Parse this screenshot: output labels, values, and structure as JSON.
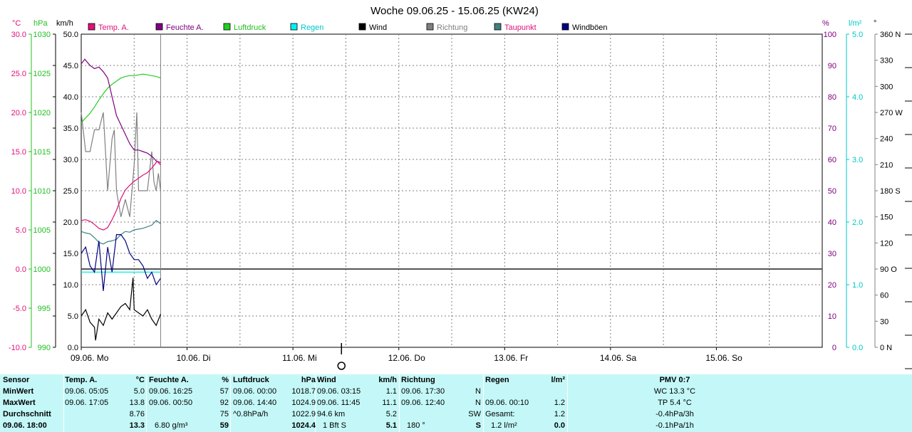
{
  "title": "Woche 09.06.25 - 15.06.25 (KW24)",
  "colors": {
    "temp": "#e0107a",
    "feuchte": "#800080",
    "luftdruck": "#20d020",
    "regen": "#00e0e0",
    "wind": "#000000",
    "richtung": "#808080",
    "taupunkt": "#408080",
    "windboeen": "#000080",
    "table_bg": "#c4f8f8"
  },
  "legend": [
    {
      "key": "temp",
      "label": "Temp. A.",
      "color": "#e0107a",
      "text_color": "#e0107a"
    },
    {
      "key": "feuchte",
      "label": "Feuchte A.",
      "color": "#800080",
      "text_color": "#800080"
    },
    {
      "key": "luftdruck",
      "label": "Luftdruck",
      "color": "#20d020",
      "text_color": "#20c020"
    },
    {
      "key": "regen",
      "label": "Regen",
      "color": "#00f0f0",
      "text_color": "#00c8c8"
    },
    {
      "key": "wind",
      "label": "Wind",
      "color": "#000000",
      "text_color": "#000000"
    },
    {
      "key": "richtung",
      "label": "Richtung",
      "color": "#808080",
      "text_color": "#808080"
    },
    {
      "key": "taupunkt",
      "label": "Taupunkt",
      "color": "#408080",
      "text_color": "#e0107a"
    },
    {
      "key": "windboeen",
      "label": "Windböen",
      "color": "#000080",
      "text_color": "#000000"
    }
  ],
  "chart_data": {
    "type": "line",
    "title": "Woche 09.06.25 - 15.06.25 (KW24)",
    "x_unit": "hours since 09.06. 00:00",
    "x_range": [
      0,
      168
    ],
    "x_ticks": [
      {
        "x": 0,
        "label": "09.06.",
        "day": "Mo"
      },
      {
        "x": 24,
        "label": "10.06.",
        "day": "Di"
      },
      {
        "x": 48,
        "label": "11.06.",
        "day": "Mi"
      },
      {
        "x": 72,
        "label": "12.06.",
        "day": "Do"
      },
      {
        "x": 96,
        "label": "13.06.",
        "day": "Fr"
      },
      {
        "x": 120,
        "label": "14.06.",
        "day": "Sa"
      },
      {
        "x": 144,
        "label": "15.06.",
        "day": "So"
      }
    ],
    "current_x": 18,
    "marker_x": 59,
    "axes": {
      "temp": {
        "unit": "°C",
        "range": [
          -10,
          30
        ],
        "ticks": [
          "30.0",
          "25.0",
          "20.0",
          "15.0",
          "10.0",
          "5.0",
          "0.0",
          "-5.0",
          "-10.0"
        ],
        "color": "#e0107a"
      },
      "luftdruck": {
        "unit": "hPa",
        "range": [
          990,
          1030
        ],
        "ticks": [
          "1030",
          "1025",
          "1020",
          "1015",
          "1010",
          "1005",
          "1000",
          "995",
          "990"
        ],
        "color": "#20c020"
      },
      "wind": {
        "unit": "km/h",
        "range": [
          0,
          50
        ],
        "ticks": [
          "50.0",
          "45.0",
          "40.0",
          "35.0",
          "30.0",
          "25.0",
          "20.0",
          "15.0",
          "10.0",
          "5.0",
          "0.0"
        ],
        "color": "#000000"
      },
      "feuchte": {
        "unit": "%",
        "range": [
          0,
          100
        ],
        "ticks": [
          "100",
          "90",
          "80",
          "70",
          "60",
          "50",
          "40",
          "30",
          "20",
          "10",
          "0"
        ],
        "color": "#800080"
      },
      "regen": {
        "unit": "l/m²",
        "range": [
          0,
          5
        ],
        "ticks": [
          "5.0",
          "4.0",
          "3.0",
          "2.0",
          "1.0",
          "0.0"
        ],
        "color": "#00c8c8"
      },
      "richtung": {
        "unit": "°",
        "range": [
          0,
          360
        ],
        "ticks": [
          "360 N",
          "330",
          "300",
          "270 W",
          "240",
          "210",
          "180 S",
          "150",
          "120",
          "90 O",
          "60",
          "30",
          "0 N"
        ],
        "color": "#000000"
      }
    },
    "series": [
      {
        "key": "temp",
        "name": "Temp. A.",
        "axis": "temp",
        "x": [
          0,
          1,
          2,
          3,
          4,
          5,
          5.1,
          6,
          7,
          8,
          9,
          10,
          11,
          12,
          13,
          14,
          15,
          16,
          17,
          17.1,
          18
        ],
        "y": [
          6.2,
          6.3,
          6.1,
          5.7,
          5.2,
          5.0,
          5.0,
          5.3,
          6.3,
          7.5,
          9.0,
          10.1,
          10.7,
          11.2,
          11.6,
          12.0,
          12.3,
          12.9,
          13.6,
          13.8,
          13.3
        ]
      },
      {
        "key": "feuchte",
        "name": "Feuchte A.",
        "axis": "feuchte",
        "x": [
          0,
          0.8,
          2,
          3,
          4,
          5,
          6,
          7,
          8,
          9,
          10,
          11,
          12,
          13,
          14,
          15,
          16,
          16.4,
          17,
          18
        ],
        "y": [
          90.5,
          92.0,
          90,
          89,
          89.5,
          88,
          86,
          80,
          74,
          71,
          68,
          65,
          63,
          63,
          62.5,
          62,
          61,
          60.5,
          59.5,
          59
        ]
      },
      {
        "key": "luftdruck",
        "name": "Luftdruck",
        "axis": "luftdruck",
        "x": [
          0,
          1,
          2,
          3,
          4,
          5,
          6,
          7,
          8,
          9,
          10,
          11,
          12,
          13,
          14,
          15,
          16,
          17,
          18
        ],
        "y": [
          1018.7,
          1019.3,
          1019.9,
          1020.7,
          1021.6,
          1022.4,
          1023.1,
          1023.6,
          1024.0,
          1024.4,
          1024.6,
          1024.7,
          1024.7,
          1024.8,
          1024.9,
          1024.8,
          1024.7,
          1024.6,
          1024.4
        ]
      },
      {
        "key": "regen",
        "name": "Regen",
        "axis": "regen",
        "x": [
          0,
          18
        ],
        "y": [
          1.2,
          1.2
        ]
      },
      {
        "key": "wind",
        "name": "Wind",
        "axis": "wind",
        "x": [
          0,
          1,
          2,
          3,
          3.25,
          4,
          5,
          6,
          7,
          8,
          9,
          10,
          11,
          11.75,
          12,
          13,
          14,
          15,
          16,
          17,
          18
        ],
        "y": [
          5.0,
          6.0,
          4.0,
          3.2,
          1.1,
          4.5,
          3.5,
          5.5,
          4.5,
          5.5,
          6.5,
          7.0,
          6.0,
          11.1,
          6.0,
          5.5,
          5.0,
          6.0,
          4.5,
          3.5,
          5.3
        ]
      },
      {
        "key": "windboeen",
        "name": "Windböen",
        "axis": "wind",
        "x": [
          0,
          1,
          2,
          3,
          4,
          5,
          6,
          7,
          8,
          9,
          10,
          11,
          12,
          13,
          14,
          15,
          16,
          17,
          18
        ],
        "y": [
          15,
          16,
          13,
          12,
          17,
          9,
          16,
          12,
          18,
          18,
          17,
          15,
          14,
          14,
          13,
          11,
          12,
          10,
          11
        ]
      },
      {
        "key": "taupunkt",
        "name": "Taupunkt",
        "axis": "temp",
        "x": [
          0,
          1,
          2,
          3,
          4,
          5,
          6,
          7,
          8,
          9,
          10,
          11,
          12,
          13,
          14,
          15,
          16,
          17,
          18
        ],
        "y": [
          4.8,
          4.6,
          4.5,
          4.0,
          3.4,
          3.2,
          3.5,
          3.6,
          3.8,
          4.4,
          4.8,
          4.7,
          5.0,
          5.1,
          5.2,
          5.4,
          5.6,
          6.2,
          5.8
        ]
      },
      {
        "key": "richtung",
        "name": "Richtung",
        "axis": "richtung",
        "x": [
          0,
          1,
          2,
          3,
          4,
          5,
          6,
          7,
          7.5,
          8,
          9,
          10,
          11,
          12,
          12.6,
          13,
          14,
          15,
          16,
          16.5,
          17,
          17.5,
          18
        ],
        "y": [
          270,
          225,
          225,
          250,
          250,
          270,
          180,
          240,
          250,
          180,
          150,
          170,
          150,
          210,
          270,
          180,
          180,
          180,
          225,
          190,
          180,
          200,
          180
        ]
      }
    ]
  },
  "table": {
    "columns": [
      {
        "key": "sensor",
        "rows": [
          "Sensor",
          "MinWert",
          "MaxWert",
          "Durchschnitt",
          "09.06. 18:00"
        ]
      },
      {
        "key": "temp",
        "head": "Temp. A.",
        "unit": "°C",
        "rows": [
          [
            "09.06.  05:05",
            "5.0"
          ],
          [
            "09.06.  17:05",
            "13.8"
          ],
          [
            "",
            "8.76"
          ],
          [
            "",
            "13.3"
          ]
        ]
      },
      {
        "key": "feuchte",
        "head": "Feuchte A.",
        "unit": "%",
        "rows": [
          [
            "09.06.  16:25",
            "57"
          ],
          [
            "09.06.  00:50",
            "92"
          ],
          [
            "",
            "75"
          ],
          [
            "6.80 g/m³",
            "59"
          ]
        ]
      },
      {
        "key": "luftdruck",
        "head": "Luftdruck",
        "unit": "hPa",
        "rows": [
          [
            "09.06.  00:00",
            "1018.7"
          ],
          [
            "09.06.  14:40",
            "1024.9"
          ],
          [
            "^0.8hPa/h",
            "1022.9"
          ],
          [
            "",
            "1024.4"
          ]
        ]
      },
      {
        "key": "wind",
        "head": "Wind",
        "unit": "km/h",
        "rows": [
          [
            "09.06.  03:15",
            "1.1"
          ],
          [
            "09.06.  11:45",
            "11.1"
          ],
          [
            "94.6 km",
            "5.2"
          ],
          [
            "1 Bft S",
            "5.1"
          ]
        ]
      },
      {
        "key": "richtung",
        "head": "Richtung",
        "unit": "",
        "rows": [
          [
            "09.06.  17:30",
            "N"
          ],
          [
            "09.06.  12:40",
            "N"
          ],
          [
            "",
            "SW"
          ],
          [
            "180 °",
            "S"
          ]
        ]
      },
      {
        "key": "regen",
        "head": "Regen",
        "unit": "l/m²",
        "rows": [
          [
            "",
            ""
          ],
          [
            "09.06.  00:10",
            "1.2"
          ],
          [
            "Gesamt:",
            "1.2"
          ],
          [
            "1.2 l/m²",
            "0.0"
          ]
        ]
      },
      {
        "key": "pmv",
        "head": "PMV 0:7",
        "rows": [
          "WC 13.3 °C",
          "TP 5.4 °C",
          "-0.4hPa/3h",
          "-0.1hPa/1h"
        ]
      }
    ]
  }
}
